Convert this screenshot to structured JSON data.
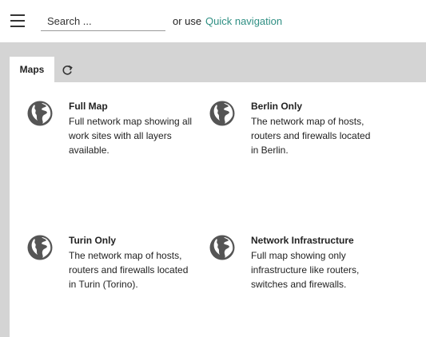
{
  "topbar": {
    "search_placeholder": "Search ...",
    "or_use": "or use",
    "quick_navigation": "Quick navigation"
  },
  "tabs": [
    {
      "label": "Maps",
      "active": true
    },
    {
      "icon": "refresh-icon"
    }
  ],
  "maps": [
    {
      "title": "Full Map",
      "description": "Full network map showing all work sites with all layers available.",
      "icon": "globe-icon"
    },
    {
      "title": "Berlin Only",
      "description": "The network map of hosts, routers and firewalls located in Berlin.",
      "icon": "globe-icon"
    },
    {
      "title": "Turin Only",
      "description": "The network map of hosts, routers and firewalls located in Turin (Torino).",
      "icon": "globe-icon"
    },
    {
      "title": "Network Infrastructure",
      "description": "Full map showing only infrastructure like routers, switches and firewalls.",
      "icon": "globe-icon"
    }
  ],
  "colors": {
    "accent": "#2f8f83",
    "tabbar": "#d4d4d4",
    "globe": "#555555"
  }
}
